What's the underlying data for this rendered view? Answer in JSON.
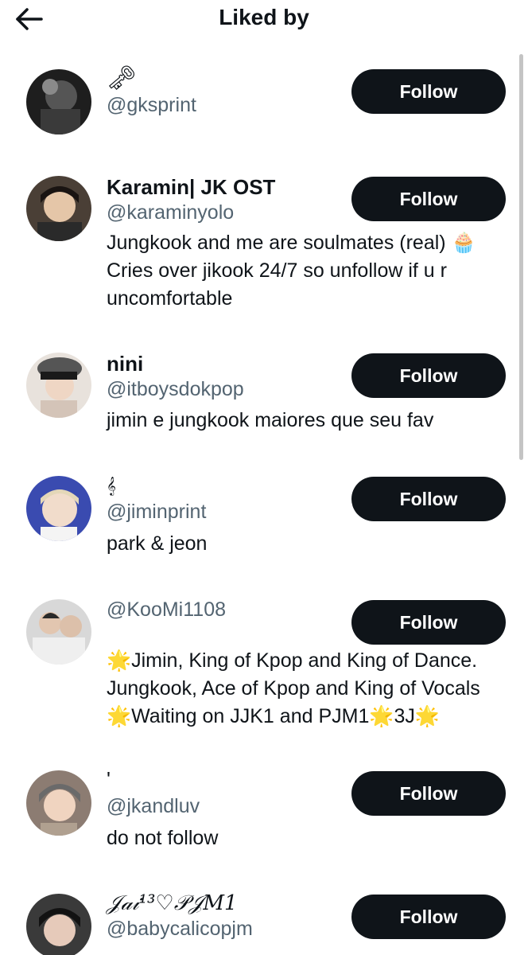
{
  "header": {
    "title": "Liked by",
    "back_icon": "arrow-left-icon"
  },
  "follow_label": "Follow",
  "users": [
    {
      "name": "🗝",
      "handle": "@gksprint",
      "bio": [],
      "avatar_color": "#2a2a2a"
    },
    {
      "name": "Karamin| JK OST",
      "handle": "@karaminyolo",
      "bio": [
        "Jungkook and me are soulmates (real) 🧁",
        "Cries over jikook 24/7 so unfollow if u r",
        "uncomfortable"
      ],
      "avatar_color": "#3b3530"
    },
    {
      "name": "nini",
      "handle": "@itboysdokpop",
      "bio": [
        "jimin e jungkook maiores que seu fav"
      ],
      "avatar_color": "#d9cfc8"
    },
    {
      "name": "𝄞",
      "handle": "@jiminprint",
      "bio": [
        "park & jeon"
      ],
      "avatar_color": "#3a4bb0"
    },
    {
      "name": "",
      "handle": "@KooMi1108",
      "bio": [
        "🌟Jimin, King of Kpop and King of Dance.",
        "Jungkook, Ace of Kpop and King of Vocals",
        "🌟Waiting on JJK1 and PJM1🌟3J🌟"
      ],
      "avatar_color": "#bdbdbd"
    },
    {
      "name": "'",
      "handle": "@jkandluv",
      "bio": [
        "do not follow"
      ],
      "avatar_color": "#9a8a80"
    },
    {
      "name": "𝒥𝒶𝒾¹³♡𝒫𝒥𝑀1",
      "handle": "@babycalicopjm",
      "bio": [],
      "avatar_color": "#2c2c2c"
    }
  ]
}
